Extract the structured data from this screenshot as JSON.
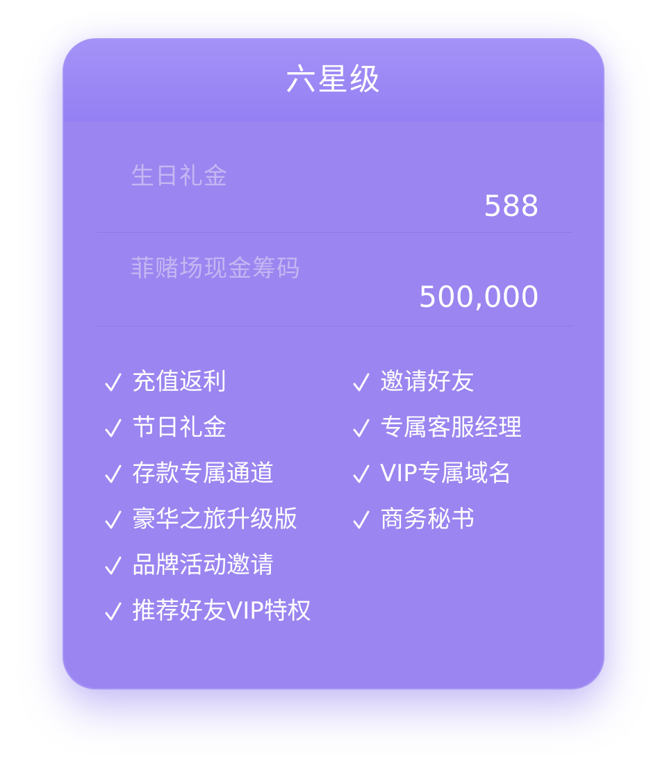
{
  "card": {
    "title": "六星级",
    "rewards": [
      {
        "label": "生日礼金",
        "value": "588"
      },
      {
        "label": "菲赌场现金筹码",
        "value": "500,000"
      }
    ],
    "benefits_left": [
      "充值返利",
      "节日礼金",
      "存款专属通道",
      "豪华之旅升级版",
      "品牌活动邀请",
      "推荐好友VIP特权"
    ],
    "benefits_right": [
      "邀请好友",
      "专属客服经理",
      "VIP专属域名",
      "商务秘书"
    ],
    "colors": {
      "card": "#9b85f0",
      "header": "#a592f7",
      "label": "#c3b7f3",
      "text": "#ffffff"
    },
    "icon": "check-icon"
  }
}
